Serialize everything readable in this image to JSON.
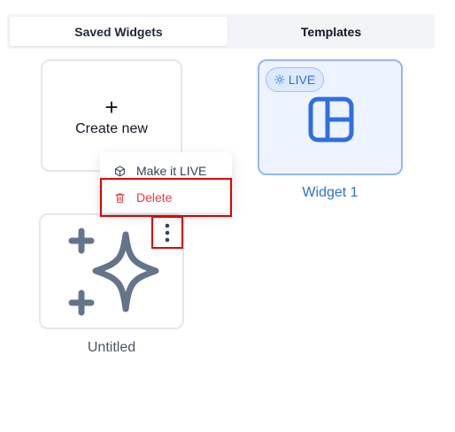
{
  "tabs": {
    "saved_widgets": "Saved Widgets",
    "templates": "Templates"
  },
  "create_card": {
    "plus": "+",
    "label": "Create new"
  },
  "widgets": [
    {
      "label": "Widget 1",
      "badge": "LIVE",
      "icon": "layout-icon",
      "status": "live"
    },
    {
      "label": "Untitled",
      "icon": "sparkles-icon"
    }
  ],
  "context_menu": {
    "make_live": "Make it LIVE",
    "delete": "Delete"
  },
  "colors": {
    "accent": "#2f6fe0",
    "delete": "#e53e3e",
    "highlight_box": "#e00000",
    "icon_gray": "#64748b"
  }
}
